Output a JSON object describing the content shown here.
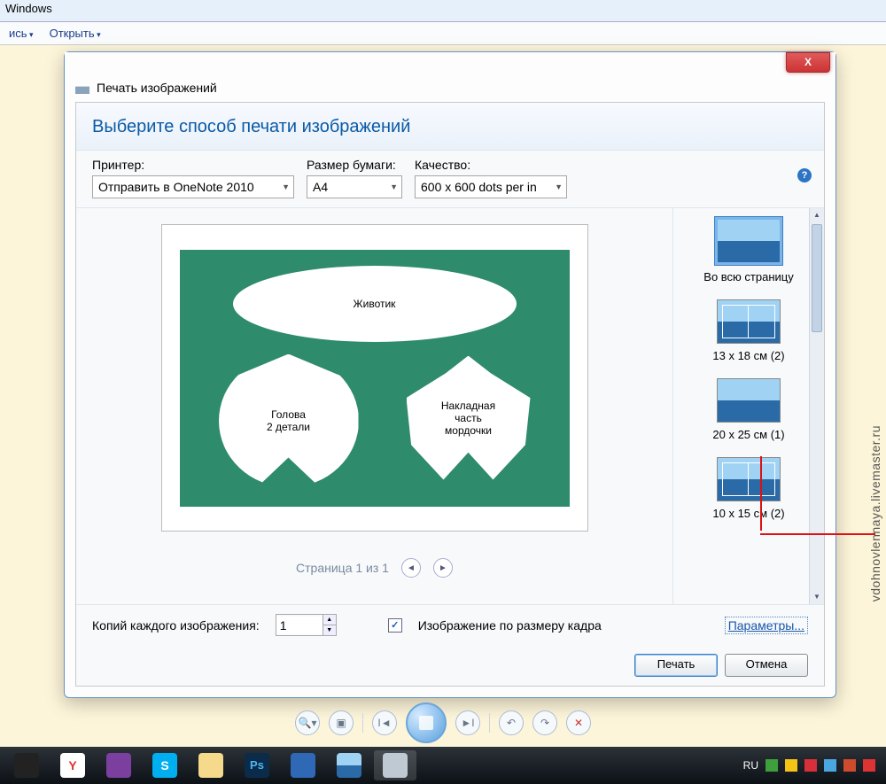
{
  "window": {
    "title": "Windows",
    "menu": [
      "ись",
      "Открыть"
    ]
  },
  "dialog": {
    "title": "Печать изображений",
    "heading": "Выберите способ печати изображений",
    "printer_label": "Принтер:",
    "printer_value": "Отправить в OneNote 2010",
    "paper_label": "Размер бумаги:",
    "paper_value": "A4",
    "quality_label": "Качество:",
    "quality_value": "600 x 600 dots per in",
    "page_counter": "Страница 1 из 1",
    "copies_label": "Копий каждого изображения:",
    "copies_value": "1",
    "fit_label": "Изображение по размеру кадра",
    "fit_checked": true,
    "params_link": "Параметры...",
    "print_btn": "Печать",
    "cancel_btn": "Отмена"
  },
  "pattern": {
    "belly": "Животик",
    "head_line1": "Голова",
    "head_line2": "2 детали",
    "muzzle_line1": "Накладная",
    "muzzle_line2": "часть",
    "muzzle_line3": "мордочки"
  },
  "layouts": [
    "Во всю страницу",
    "13 x 18 см (2)",
    "20 x 25 см (1)",
    "10 x 15 см (2)"
  ],
  "tray": {
    "lang": "RU"
  },
  "watermark": "vdohnovlennaya.livemaster.ru"
}
